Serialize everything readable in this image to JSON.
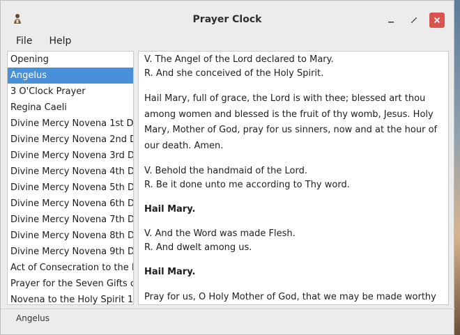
{
  "window": {
    "title": "Prayer Clock",
    "app_icon": "praying-person-icon"
  },
  "menu": {
    "items": [
      "File",
      "Help"
    ]
  },
  "sidebar": {
    "items": [
      "Opening",
      "Angelus",
      "3 O'Clock Prayer",
      "Regina Caeli",
      "Divine Mercy Novena 1st D",
      "Divine Mercy Novena 2nd D",
      "Divine Mercy Novena 3rd D",
      "Divine Mercy Novena 4th D",
      "Divine Mercy Novena 5th D",
      "Divine Mercy Novena 6th D",
      "Divine Mercy Novena 7th D",
      "Divine Mercy Novena 8th D",
      "Divine Mercy Novena 9th D",
      "Act of Consecration to the I",
      "Prayer for the Seven Gifts c",
      "Novena to the Holy Spirit 1"
    ],
    "selected_index": 1
  },
  "prayer": {
    "p1_l1": "V. The Angel of the Lord declared to Mary.",
    "p1_l2": "R. And she conceived of the Holy Spirit.",
    "p2_l1": "Hail Mary, full of grace, the Lord is with thee; blessed art thou",
    "p2_l2": "among women and blessed is the fruit of thy womb, Jesus. Holy",
    "p2_l3": "Mary, Mother of God, pray for us sinners, now and at the hour of",
    "p2_l4": "our death. Amen.",
    "p3_l1": "V. Behold the handmaid of the Lord.",
    "p3_l2": "R. Be it done unto me according to Thy word.",
    "p4": "Hail Mary.",
    "p5_l1": "V. And the Word was made Flesh.",
    "p5_l2": "R. And dwelt among us.",
    "p6": "Hail Mary.",
    "p7_l1": "Pray for us, O Holy Mother of God, that we may be made worthy of"
  },
  "status": {
    "text": "Angelus"
  }
}
